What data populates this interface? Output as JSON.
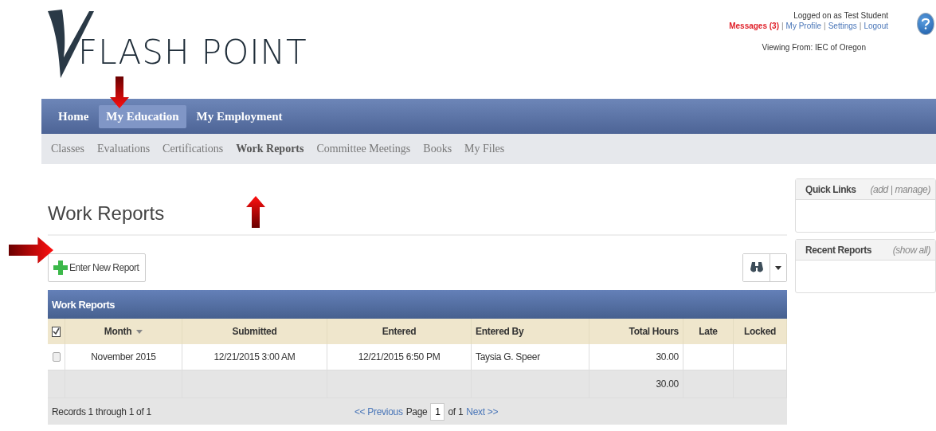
{
  "logo": {
    "text": "FLASH POINT"
  },
  "user_panel": {
    "logged_on": "Logged on as Test Student",
    "links": [
      {
        "label": "Messages (3)",
        "kind": "alert"
      },
      {
        "label": "My Profile",
        "kind": "link"
      },
      {
        "label": "Settings",
        "kind": "link"
      },
      {
        "label": "Logout",
        "kind": "link"
      }
    ],
    "separator": "|",
    "viewing_from": "Viewing From: IEC of Oregon"
  },
  "main_nav": [
    {
      "label": "Home",
      "selected": false
    },
    {
      "label": "My Education",
      "selected": true
    },
    {
      "label": "My Employment",
      "selected": false
    }
  ],
  "sub_nav": [
    {
      "label": "Classes",
      "selected": false
    },
    {
      "label": "Evaluations",
      "selected": false
    },
    {
      "label": "Certifications",
      "selected": false
    },
    {
      "label": "Work Reports",
      "selected": true
    },
    {
      "label": "Committee Meetings",
      "selected": false
    },
    {
      "label": "Books",
      "selected": false
    },
    {
      "label": "My Files",
      "selected": false
    }
  ],
  "page_title": "Work Reports",
  "new_button": "Enter New Report",
  "table": {
    "title": "Work Reports",
    "columns": [
      {
        "label": "Month",
        "sorted": true
      },
      {
        "label": "Submitted",
        "sorted": false
      },
      {
        "label": "Entered",
        "sorted": false
      },
      {
        "label": "Entered By",
        "sorted": false
      },
      {
        "label": "Total Hours",
        "sorted": false
      },
      {
        "label": "Late",
        "sorted": false
      },
      {
        "label": "Locked",
        "sorted": false
      }
    ],
    "rows": [
      {
        "checked": false,
        "cells": [
          "November 2015",
          "12/21/2015 3:00 AM",
          "12/21/2015 6:50 PM",
          "Taysia G. Speer",
          "30.00"
        ]
      }
    ],
    "totals": {
      "total_hours": "30.00"
    },
    "records": "Records 1 through 1 of 1",
    "pager": {
      "previous": "<< Previous",
      "page_label": "Page",
      "page": "1",
      "of": "of 1",
      "next": "Next >>"
    }
  },
  "sidebar": [
    {
      "title": "Quick Links",
      "actions": "(add | manage)"
    },
    {
      "title": "Recent Reports",
      "actions": "(show all)"
    }
  ]
}
